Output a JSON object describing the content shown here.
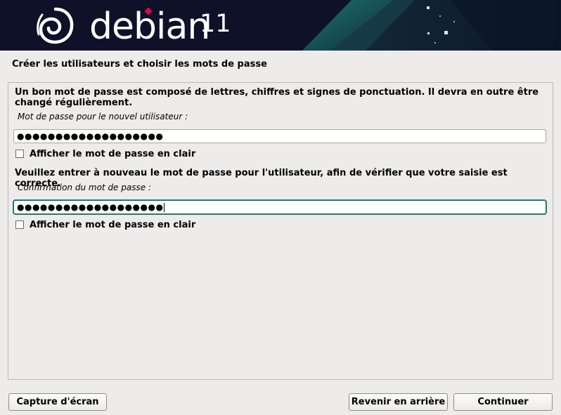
{
  "banner": {
    "brand": "debian",
    "version": "11"
  },
  "page_title": "Créer les utilisateurs et choisir les mots de passe",
  "password_section": {
    "help_text": "Un bon mot de passe est composé de lettres, chiffres et signes de ponctuation. Il devra en outre être changé régulièrement.",
    "label": "Mot de passe pour le nouvel utilisateur :",
    "value": "●●●●●●●●●●●●●●●●●●●",
    "show_password_label": "Afficher le mot de passe en clair",
    "show_password_checked": false
  },
  "confirm_section": {
    "help_text": "Veuillez entrer à nouveau le mot de passe pour l'utilisateur, afin de vérifier que votre saisie est correcte.",
    "label": "Confirmation du mot de passe :",
    "value": "●●●●●●●●●●●●●●●●●●●",
    "show_password_label": "Afficher le mot de passe en clair",
    "show_password_checked": false
  },
  "buttons": {
    "screenshot": "Capture d'écran",
    "back": "Revenir en arrière",
    "continue": "Continuer"
  },
  "colors": {
    "banner_bg": "#0e1127",
    "banner_accent": "#1b5f63",
    "brand_dot": "#d70751",
    "focus_border": "#1e6f6b"
  }
}
